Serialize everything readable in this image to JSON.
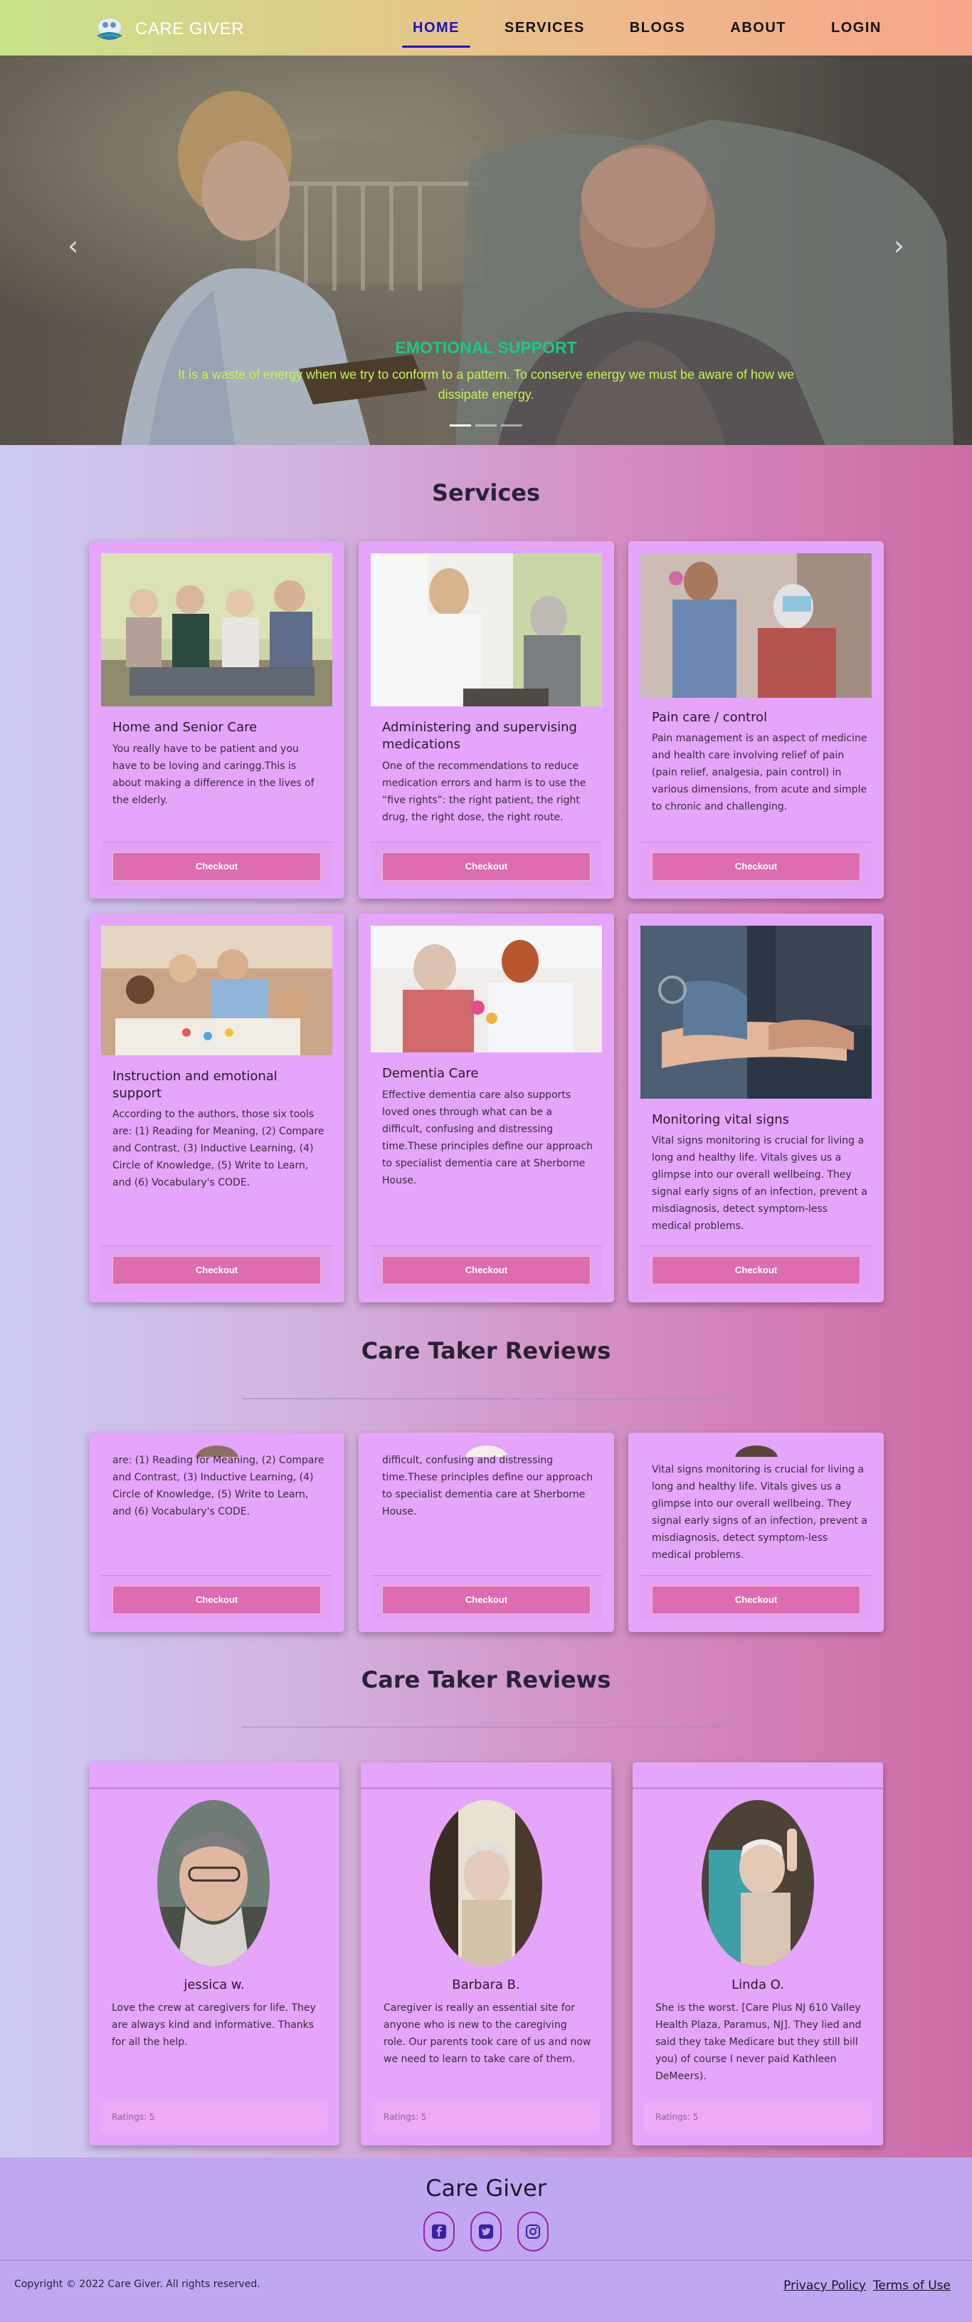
{
  "nav": {
    "brand": "CARE GIVER",
    "items": [
      {
        "label": "HOME",
        "active": true
      },
      {
        "label": "SERVICES",
        "active": false
      },
      {
        "label": "BLOGS",
        "active": false
      },
      {
        "label": "ABOUT",
        "active": false
      },
      {
        "label": "LOGIN",
        "active": false
      }
    ]
  },
  "hero": {
    "title": "EMOTIONAL SUPPORT",
    "text": "It is a waste of energy when we try to conform to a pattern. To conserve energy we must be aware of how we dissipate energy.",
    "prev": "‹",
    "next": "›",
    "slide_count": 3,
    "active_slide": 1
  },
  "services": {
    "title": "Services",
    "cards": [
      {
        "title": "Home and Senior Care",
        "text": "You really have to be patient and you have to be loving and caringg.This is about making a difference in the lives of the elderly.",
        "button": "Checkout",
        "image": "seniors-sitting-photo"
      },
      {
        "title": "Administering and supervising medications",
        "text": "One of the recommendations to reduce medication errors and harm is to use the “five rights”: the right patient, the right drug, the right dose, the right route.",
        "button": "Checkout",
        "image": "nurse-with-elderly-woman-photo"
      },
      {
        "title": "Pain care / control",
        "text": "Pain management is an aspect of medicine and health care involving relief of pain (pain relief, analgesia, pain control) in various dimensions, from acute and simple to chronic and challenging.",
        "button": "Checkout",
        "image": "physio-exercise-photo"
      },
      {
        "title": "Instruction and emotional support",
        "text": "According to the authors, those six tools are: (1) Reading for Meaning, (2) Compare and Contrast, (3) Inductive Learning, (4) Circle of Knowledge, (5) Write to Learn, and (6) Vocabulary's CODE.",
        "button": "Checkout",
        "image": "teacher-with-kids-photo"
      },
      {
        "title": "Dementia Care",
        "text": "Effective dementia care also supports loved ones through what can be a difficult, confusing and distressing time.These principles define our approach to specialist dementia care at Sherborne House.",
        "button": "Checkout",
        "image": "carer-with-elderly-woman-photo"
      },
      {
        "title": "Monitoring vital signs",
        "text": "Vital signs monitoring is crucial for living a long and healthy life. Vitals gives us a glimpse into our overall wellbeing. They signal early signs of an infection, prevent a misdiagnosis, detect symptom-less medical problems.",
        "button": "Checkout",
        "image": "blood-pressure-photo"
      }
    ]
  },
  "reviews_overlap": {
    "title": "Care Taker Reviews",
    "cards": [
      {
        "text": "are: (1) Reading for Meaning, (2) Compare and Contrast, (3) Inductive Learning, (4) Circle of Knowledge, (5) Write to Learn, and (6) Vocabulary's CODE.",
        "button": "Checkout"
      },
      {
        "text": "difficult, confusing and distressing time.These principles define our approach to specialist dementia care at Sherborne House.",
        "button": "Checkout"
      },
      {
        "text": "Vital signs monitoring is crucial for living a long and healthy life. Vitals gives us a glimpse into our overall wellbeing. They signal early signs of an infection, prevent a misdiagnosis, detect symptom-less medical problems.",
        "button": "Checkout"
      }
    ]
  },
  "reviews": {
    "title": "Care Taker Reviews",
    "cards": [
      {
        "name": "jessica w.",
        "text": "Love the crew at caregivers for life. They are always kind and informative. Thanks for all the help.",
        "rating": "Ratings: 5"
      },
      {
        "name": "Barbara B.",
        "text": "Caregiver is really an essential site for anyone who is new to the caregiving role. Our parents took care of us and now we need to learn to take care of them.",
        "rating": "Ratings: 5"
      },
      {
        "name": "Linda O.",
        "text": "She is the worst. [Care Plus NJ 610 Valley Health Plaza, Paramus, NJ]. They lied and said they take Medicare but they still bill you) of course I never paid Kathleen DeMeers).",
        "rating": "Ratings: 5"
      }
    ]
  },
  "footer": {
    "title": "Care Giver",
    "social": [
      "facebook-icon",
      "twitter-icon",
      "instagram-icon"
    ],
    "copyright": "Copyright © 2022 Care Giver. All rights reserved.",
    "links": [
      "Privacy Policy",
      "Terms of Use"
    ]
  },
  "colors": {
    "accent": "#1b12c8",
    "card": "#e4a5fb",
    "button": "#de6cb0",
    "hero_title": "#19c986",
    "hero_text": "#c4f255",
    "footer": "#bfa7f2"
  }
}
